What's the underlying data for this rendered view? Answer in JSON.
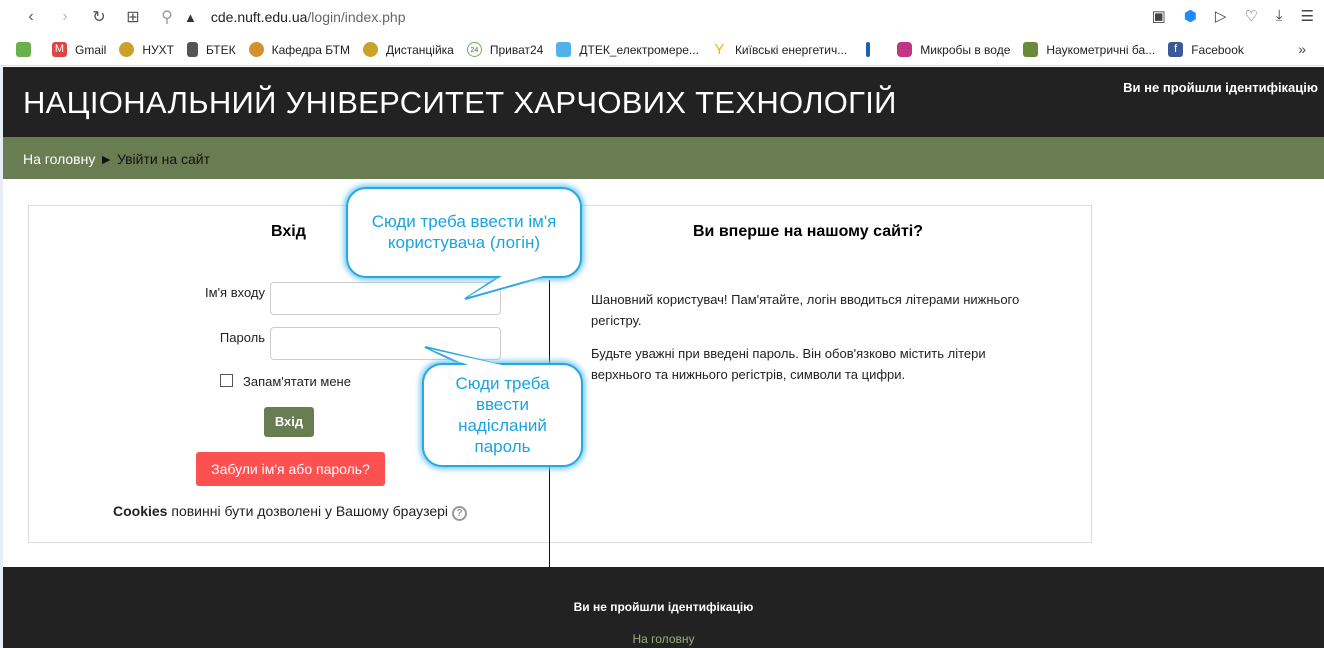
{
  "browser": {
    "url_host": "cde.nuft.edu.ua",
    "url_path": "/login/index.php",
    "bookmarks": [
      {
        "label": "Gmail",
        "color": "#d44"
      },
      {
        "label": "НУХТ",
        "color": "#c9a227"
      },
      {
        "label": "БТЕК",
        "color": "#555"
      },
      {
        "label": "Кафедра БТМ",
        "color": "#d4902a"
      },
      {
        "label": "Дистанційка",
        "color": "#c9a227"
      },
      {
        "label": "Приват24",
        "color": "#6ab04c"
      },
      {
        "label": "ДТЕК_електромере...",
        "color": "#4fb3e8"
      },
      {
        "label": "Київські енергетич...",
        "color": "#f4b400"
      },
      {
        "label": "",
        "color": "#1f5fb0"
      },
      {
        "label": "Микробы в воде",
        "color": "#c13584"
      },
      {
        "label": "Наукометричні ба...",
        "color": "#6a8a3a"
      },
      {
        "label": "Facebook",
        "color": "#3b5998"
      }
    ]
  },
  "header": {
    "title": "НАЦІОНАЛЬНИЙ УНІВЕРСИТЕТ ХАРЧОВИХ ТЕХНОЛОГІЙ",
    "ident": "Ви не пройшли ідентифікацію"
  },
  "breadcrumb": {
    "home": "На головну",
    "sep": "►",
    "current": "Увійти на сайт"
  },
  "login": {
    "heading": "Вхід",
    "username_label": "Ім'я входу",
    "password_label": "Пароль",
    "remember": "Запам'ятати мене",
    "submit": "Вхід",
    "forgot": "Забули ім'я або пароль?",
    "cookies_bold": "Cookies",
    "cookies_text": " повинні бути дозволені у Вашому браузері"
  },
  "info": {
    "heading": "Ви вперше на нашому сайті?",
    "p1": "Шановний користувач! Пам'ятайте, логін вводиться літерами нижнього регістру.",
    "p2": "Будьте уважні при введені пароль. Він обов'язково містить літери верхнього та нижнього регістрів, символи та цифри."
  },
  "callouts": {
    "login": "Сюди треба ввести ім'я користувача  (логін)",
    "password": "Сюди треба ввести надісланий пароль"
  },
  "footer": {
    "ident": "Ви не пройшли ідентифікацію",
    "home": "На головну"
  }
}
